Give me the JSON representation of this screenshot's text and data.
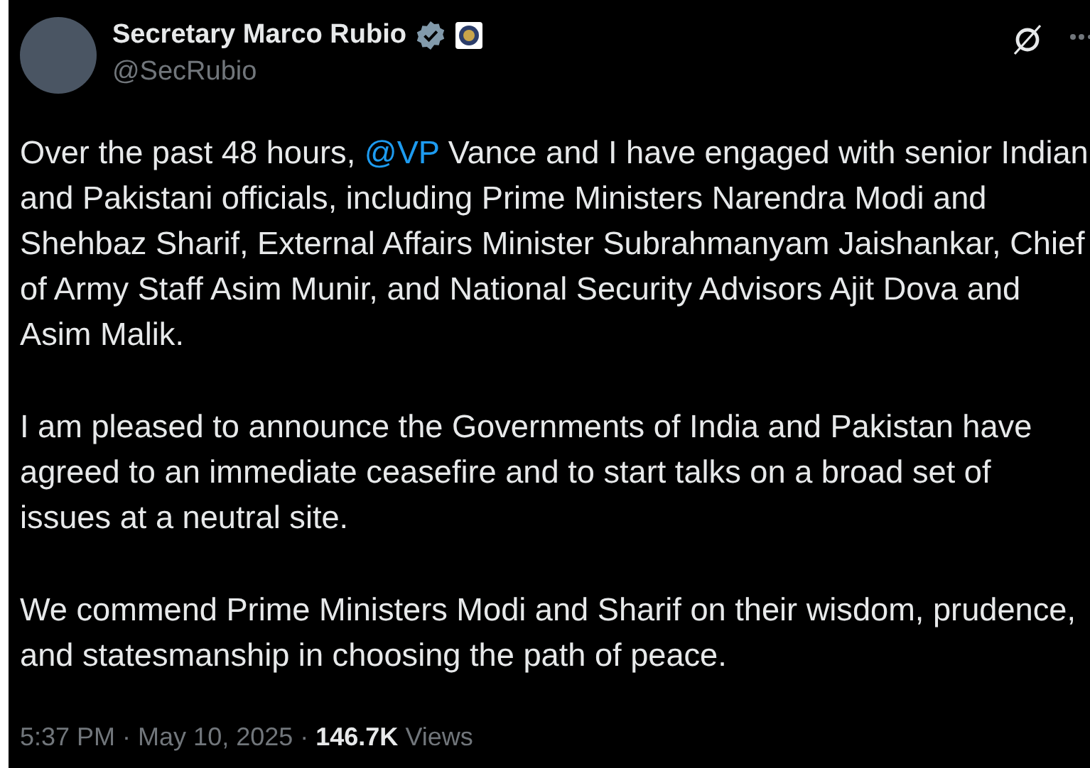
{
  "author": {
    "name": "Secretary Marco Rubio",
    "handle": "@SecRubio",
    "verified": true
  },
  "paragraphs": [
    {
      "before": "Over the past 48 hours, ",
      "mention": "@VP",
      "after": " Vance and I have engaged with senior Indian and Pakistani officials, including Prime Ministers Narendra Modi and Shehbaz Sharif, External Affairs Minister Subrahmanyam Jaishankar, Chief of Army Staff Asim Munir, and National Security Advisors Ajit Dova and Asim Malik."
    },
    {
      "before": "I am pleased to announce the Governments of India and Pakistan have agreed to an immediate ceasefire and to start talks on a broad set of issues at a neutral site."
    },
    {
      "before": "We commend Prime Ministers Modi and Sharif on their wisdom, prudence, and statesmanship in choosing the path of peace."
    }
  ],
  "footer": {
    "separator": "·",
    "time": "5:37 PM",
    "date": "May 10, 2025",
    "views_count": "146.7K",
    "views_label": "Views"
  }
}
